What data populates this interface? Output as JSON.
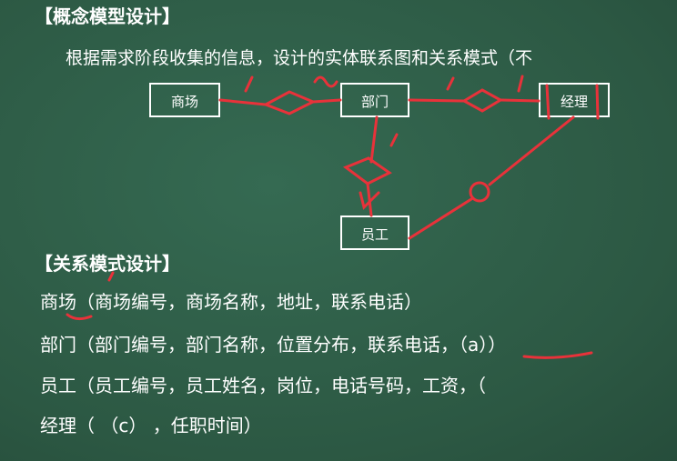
{
  "heading_concept": "【概念模型设计】",
  "intro_text": "根据需求阶段收集的信息，设计的实体联系图和关系模式（不",
  "entities": {
    "mall": "商场",
    "department": "部门",
    "manager": "经理",
    "employee": "员工"
  },
  "annotations": {
    "mall_dept_left": "1",
    "mall_dept_right": "n",
    "dept_mgr_left": "1",
    "dept_mgr_right": "1",
    "dept_staff_top": "1",
    "dept_staff_bottom": "n"
  },
  "heading_relational": "【关系模式设计】",
  "relations": [
    "商场（商场编号，商场名称，地址，联系电话）",
    "部门（部门编号，部门名称，位置分布，联系电话，（a））",
    "员工（员工编号，员工姓名，岗位，电话号码，工资，（",
    "经理（  （c）  ，任职时间）"
  ],
  "colors": {
    "board": "#2f5d48",
    "chalk": "#ffffff",
    "marker": "#e8323a"
  }
}
